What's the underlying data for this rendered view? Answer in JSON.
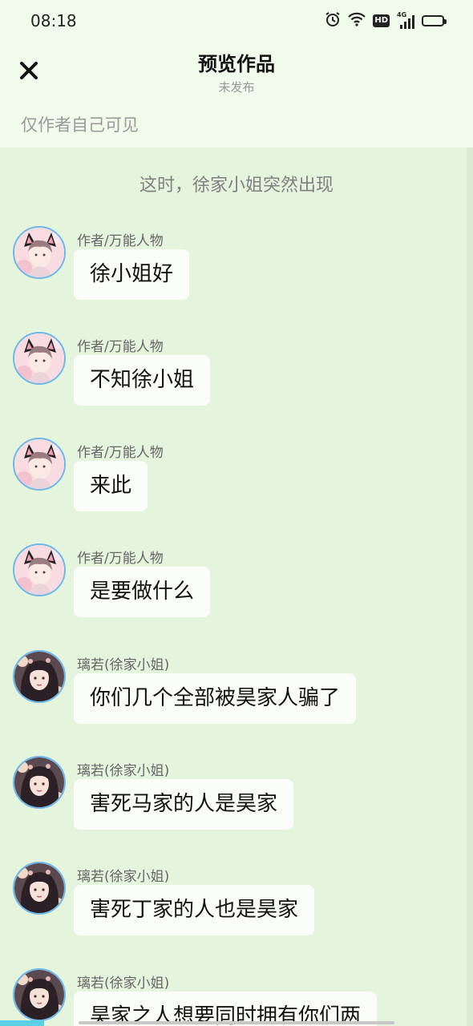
{
  "status_bar": {
    "time": "08:18",
    "icons": [
      "alarm-icon",
      "wifi-icon",
      "hd-icon",
      "4g-signal-icon",
      "battery-icon"
    ],
    "hd_label": "HD",
    "network_label": "4G"
  },
  "header": {
    "close_icon": "close-icon",
    "title": "预览作品",
    "subtitle": "未发布",
    "visibility_note": "仅作者自己可见"
  },
  "story": {
    "narration": "这时，徐家小姐突然出现",
    "messages": [
      {
        "speaker": "作者/万能人物",
        "text": "徐小姐好",
        "avatar": "pink-boy-cat-ears"
      },
      {
        "speaker": "作者/万能人物",
        "text": "不知徐小姐",
        "avatar": "pink-boy-cat-ears"
      },
      {
        "speaker": "作者/万能人物",
        "text": "来此",
        "avatar": "pink-boy-cat-ears"
      },
      {
        "speaker": "作者/万能人物",
        "text": "是要做什么",
        "avatar": "pink-boy-cat-ears"
      },
      {
        "speaker": "璃若(徐家小姐)",
        "text": "你们几个全部被昊家人骗了",
        "avatar": "dark-hair-girl"
      },
      {
        "speaker": "璃若(徐家小姐)",
        "text": "害死马家的人是昊家",
        "avatar": "dark-hair-girl"
      },
      {
        "speaker": "璃若(徐家小姐)",
        "text": "害死丁家的人也是昊家",
        "avatar": "dark-hair-girl"
      },
      {
        "speaker": "璃若(徐家小姐)",
        "text": "昊家之人想要同时拥有你们两",
        "avatar": "dark-hair-girl"
      }
    ]
  },
  "colors": {
    "background": "#e5f4dd",
    "header_background": "#f1fbec",
    "bubble": "#fbfdf9",
    "avatar_ring": "#6cb8ea"
  }
}
